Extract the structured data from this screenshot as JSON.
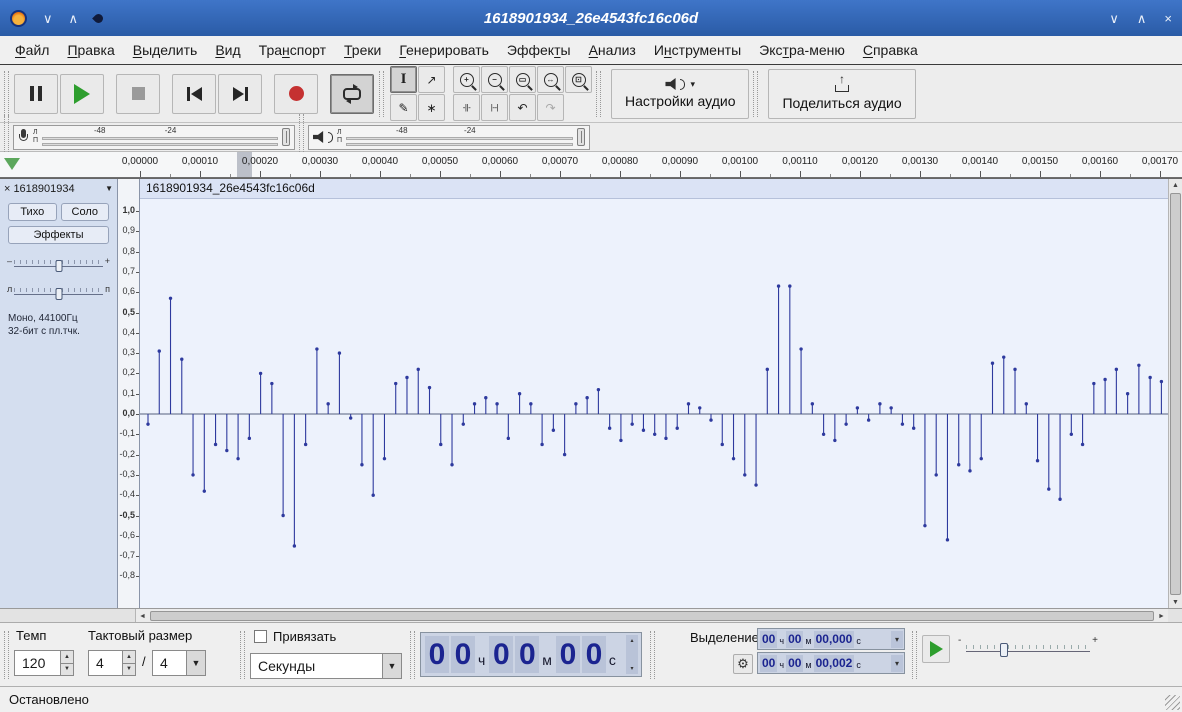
{
  "window": {
    "title": "1618901934_26e4543fc16c06d"
  },
  "menu": {
    "items": [
      {
        "label": "Файл",
        "accel": 0
      },
      {
        "label": "Правка",
        "accel": 0
      },
      {
        "label": "Выделить",
        "accel": 0
      },
      {
        "label": "Вид",
        "accel": 0
      },
      {
        "label": "Транспорт",
        "accel": 3
      },
      {
        "label": "Треки",
        "accel": 0
      },
      {
        "label": "Генерировать",
        "accel": 0
      },
      {
        "label": "Эффекты",
        "accel": 5
      },
      {
        "label": "Анализ",
        "accel": 0
      },
      {
        "label": "Инструменты",
        "accel": 1
      },
      {
        "label": "Экстра-меню",
        "accel": 3
      },
      {
        "label": "Справка",
        "accel": 0
      }
    ]
  },
  "toolbar": {
    "audio_setup_label": "Настройки аудио",
    "share_audio_label": "Поделиться аудио",
    "tools": {
      "selection_glyph": "I",
      "envelope_glyph": "↗",
      "draw_glyph": "✎",
      "multi_glyph": "∗",
      "zoom_in_glyph": "+",
      "zoom_out_glyph": "−",
      "zoom_sel_glyph": "▭",
      "zoom_toggle_glyph": "↔",
      "zoom_fit_glyph": "⊡",
      "trim_glyph": "-||-",
      "silence_glyph": "|--|",
      "undo_glyph": "↶",
      "redo_glyph": "↷"
    }
  },
  "meters": {
    "record": {
      "channels": [
        "Л",
        "П"
      ],
      "scale": [
        "-48",
        "-24"
      ]
    },
    "playback": {
      "channels": [
        "Л",
        "П"
      ],
      "scale": [
        "-48",
        "-24"
      ]
    }
  },
  "timeline": {
    "ticks": [
      "0,00000",
      "0,00010",
      "0,00020",
      "0,00030",
      "0,00040",
      "0,00050",
      "0,00060",
      "0,00070",
      "0,00080",
      "0,00090",
      "0,00100",
      "0,00110",
      "0,00120",
      "0,00130",
      "0,00140",
      "0,00150",
      "0,00160",
      "0,00170"
    ]
  },
  "track": {
    "name": "1618901934",
    "clip_title": "1618901934_26e4543fc16c06d",
    "mute_label": "Тихо",
    "solo_label": "Соло",
    "effects_label": "Эффекты",
    "gain_min": "–",
    "gain_max": "+",
    "pan_left": "л",
    "pan_right": "п",
    "info_line1": "Моно, 44100Гц",
    "info_line2": "32-бит с пл.тчк.",
    "ruler_labels": [
      "1,0",
      "0,9",
      "0,8",
      "0,7",
      "0,6",
      "0,5",
      "0,4",
      "0,3",
      "0,2",
      "0,1",
      "0,0",
      "-0,1",
      "-0,2",
      "-0,3",
      "-0,4",
      "-0,5",
      "-0,6",
      "-0,7",
      "-0,8"
    ],
    "ruler_bold": [
      "1,0",
      "0,5",
      "0,0",
      "-0,5"
    ]
  },
  "waveform": {
    "color": "#2e3a9e",
    "samples": [
      -0.05,
      0.31,
      0.57,
      0.27,
      -0.3,
      -0.38,
      -0.15,
      -0.18,
      -0.22,
      -0.12,
      0.2,
      0.15,
      -0.5,
      -0.65,
      -0.15,
      0.32,
      0.05,
      0.3,
      -0.02,
      -0.25,
      -0.4,
      -0.22,
      0.15,
      0.18,
      0.22,
      0.13,
      -0.15,
      -0.25,
      -0.05,
      0.05,
      0.08,
      0.05,
      -0.12,
      0.1,
      0.05,
      -0.15,
      -0.08,
      -0.2,
      0.05,
      0.08,
      0.12,
      -0.07,
      -0.13,
      -0.05,
      -0.08,
      -0.1,
      -0.12,
      -0.07,
      0.05,
      0.03,
      -0.03,
      -0.15,
      -0.22,
      -0.3,
      -0.35,
      0.22,
      0.63,
      0.63,
      0.32,
      0.05,
      -0.1,
      -0.13,
      -0.05,
      0.03,
      -0.03,
      0.05,
      0.03,
      -0.05,
      -0.07,
      -0.55,
      -0.3,
      -0.62,
      -0.25,
      -0.28,
      -0.22,
      0.25,
      0.28,
      0.22,
      0.05,
      -0.23,
      -0.37,
      -0.42,
      -0.1,
      -0.15,
      0.15,
      0.17,
      0.22,
      0.1,
      0.24,
      0.18,
      0.16
    ]
  },
  "bottom": {
    "tempo_label": "Темп",
    "tempo_value": "120",
    "time_signature_label": "Тактовый размер",
    "time_signature_upper": "4",
    "time_signature_divider": "/",
    "time_signature_lower": "4",
    "snap_label": "Привязать",
    "units_value": "Секунды",
    "time_display": {
      "groups": [
        {
          "digits": "00",
          "unit": "ч"
        },
        {
          "digits": "00",
          "unit": "м"
        },
        {
          "digits": "00",
          "unit": "с"
        }
      ]
    },
    "selection_label": "Выделение",
    "selection_fields": [
      {
        "groups": [
          {
            "digits": "00",
            "unit": "ч"
          },
          {
            "digits": "00",
            "unit": "м"
          },
          {
            "digits": "00,000",
            "unit": "с"
          }
        ]
      },
      {
        "groups": [
          {
            "digits": "00",
            "unit": "ч"
          },
          {
            "digits": "00",
            "unit": "м"
          },
          {
            "digits": "00,002",
            "unit": "с"
          }
        ]
      }
    ]
  },
  "status": {
    "text": "Остановлено"
  }
}
